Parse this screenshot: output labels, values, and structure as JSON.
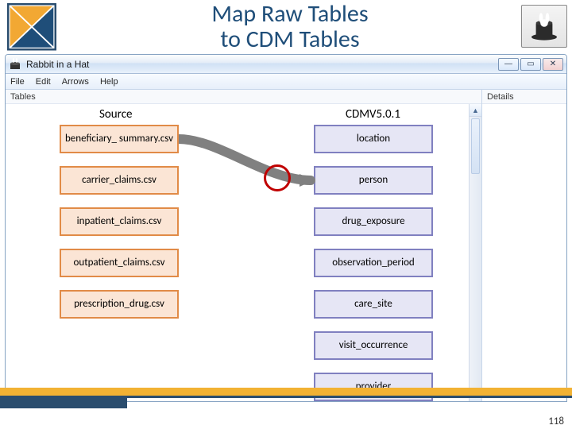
{
  "slide": {
    "title_line1": "Map Raw Tables",
    "title_line2": "to CDM Tables",
    "page_number": "118"
  },
  "window": {
    "title": "Rabbit in a Hat",
    "menus": [
      "File",
      "Edit",
      "Arrows",
      "Help"
    ],
    "win_buttons": {
      "min": "—",
      "max": "▭",
      "close": "✕"
    }
  },
  "panels": {
    "tables_label": "Tables",
    "details_label": "Details"
  },
  "columns": {
    "source_header": "Source",
    "target_header": "CDMV5.0.1"
  },
  "source_tables": [
    "beneficiary_ summary.csv",
    "carrier_claims.csv",
    "inpatient_claims.csv",
    "outpatient_claims.csv",
    "prescription_drug.csv"
  ],
  "target_tables": [
    "location",
    "person",
    "drug_exposure",
    "observation_period",
    "care_site",
    "visit_occurrence",
    "provider"
  ],
  "mapping": {
    "from_index": 0,
    "to_index": 1
  },
  "colors": {
    "title": "#1f4e79",
    "source_fill": "#fbe5d5",
    "source_border": "#e18b47",
    "target_fill": "#e6e6f5",
    "target_border": "#8080c0",
    "highlight_circle": "#c00000",
    "footer_accent": "#f2b233",
    "footer_dark": "#2a4d6e"
  }
}
